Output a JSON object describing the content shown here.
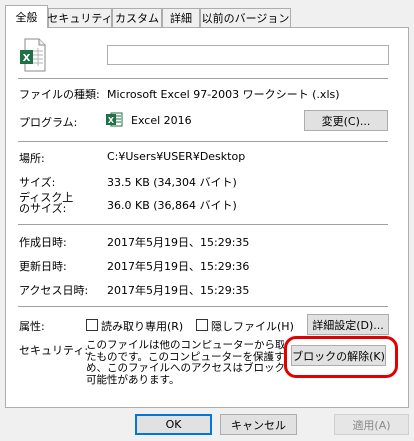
{
  "tabs": [
    {
      "label": "全般",
      "active": true
    },
    {
      "label": "セキュリティ",
      "active": false
    },
    {
      "label": "カスタム",
      "active": false
    },
    {
      "label": "詳細",
      "active": false
    },
    {
      "label": "以前のバージョン",
      "active": false
    }
  ],
  "file_icon": "excel-file-icon",
  "filename_value": "",
  "type": {
    "label": "ファイルの種類:",
    "value": "Microsoft Excel 97-2003 ワークシート (.xls)"
  },
  "program": {
    "label": "プログラム:",
    "app_icon": "excel-app-icon",
    "value": "Excel 2016",
    "change_button": "変更(C)..."
  },
  "location": {
    "label": "場所:",
    "value": "C:¥Users¥USER¥Desktop"
  },
  "size": {
    "label": "サイズ:",
    "value": "33.5 KB (34,304 バイト)"
  },
  "disk_size": {
    "label_line1": "ディスク上",
    "label_line2": "のサイズ:",
    "value": "36.0 KB (36,864 バイト)"
  },
  "created": {
    "label": "作成日時:",
    "value": "2017年5月19日、15:29:35"
  },
  "modified": {
    "label": "更新日時:",
    "value": "2017年5月19日、15:29:36"
  },
  "accessed": {
    "label": "アクセス日時:",
    "value": "2017年5月19日、15:29:35"
  },
  "attributes": {
    "label": "属性:",
    "readonly_label": "読み取り専用(R)",
    "readonly_checked": false,
    "hidden_label": "隠しファイル(H)",
    "hidden_checked": false,
    "advanced_button": "詳細設定(D)..."
  },
  "security": {
    "label": "セキュリティ:",
    "text_lines": [
      "このファイルは他のコンピューターから取得し",
      "たものです。このコンピューターを保護するた",
      "め、このファイルへのアクセスはブロックされる",
      "可能性があります。"
    ],
    "unblock_button": "ブロックの解除(K)",
    "highlight_color": "#e20000"
  },
  "footer": {
    "ok": "OK",
    "cancel": "キャンセル",
    "apply": "適用(A)"
  }
}
